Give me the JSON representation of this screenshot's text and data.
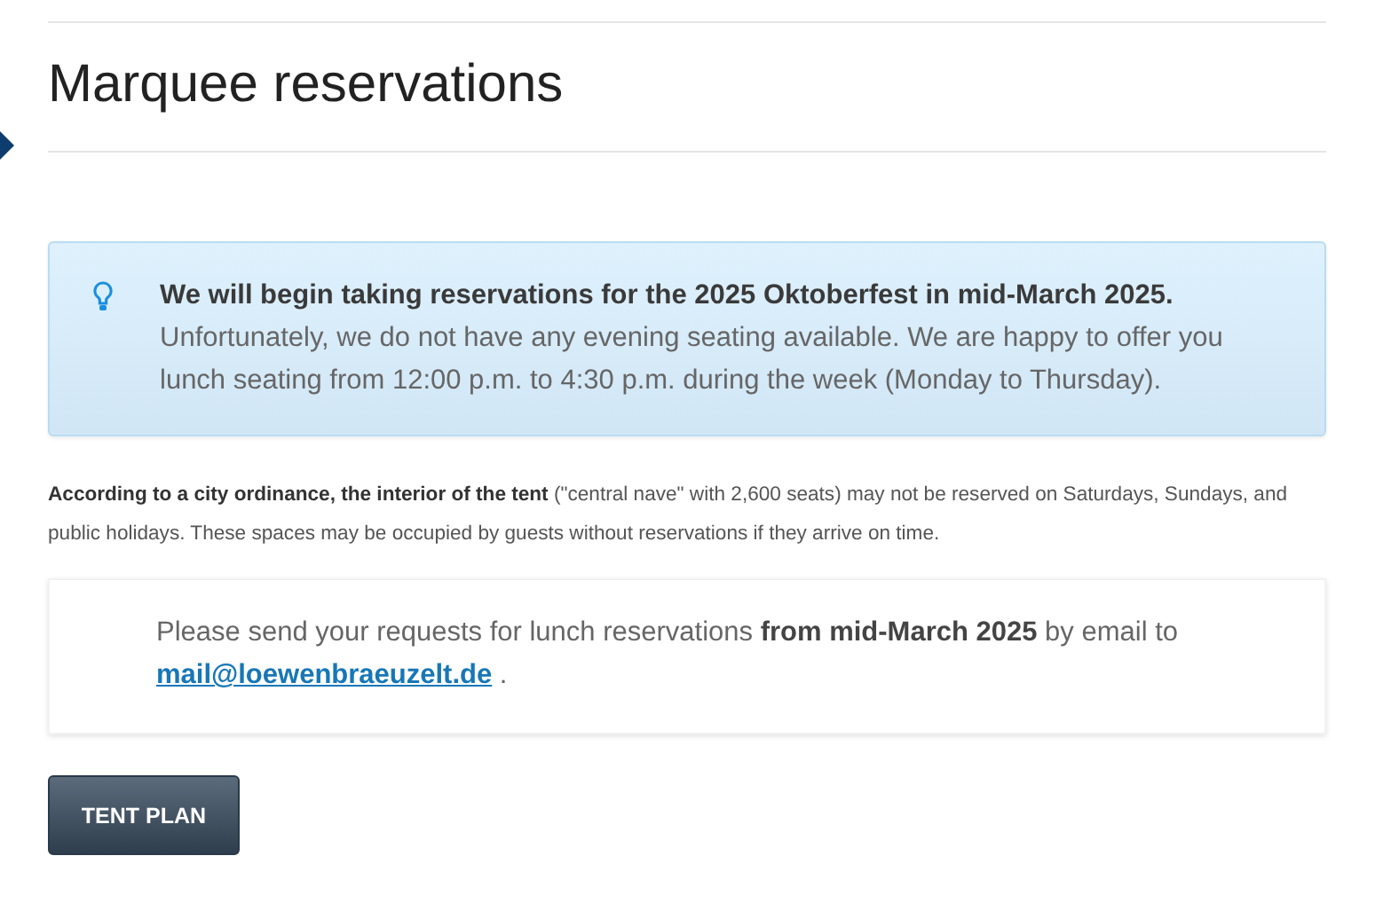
{
  "title": "Marquee reservations",
  "notice": {
    "headline": "We will begin taking reservations for the 2025 Oktoberfest in mid-March 2025.",
    "body": "Unfortunately, we do not have any evening seating available. We are happy to offer you lunch seating from 12:00 p.m. to 4:30 p.m. during the week (Monday to Thursday)."
  },
  "ordinance": "**According to a city ordinance, the interior of the tent** (\"central nave\" with 2,600 seats) may not be reserved on Saturdays, Sundays, and public holidays. These spaces may be occupied by guests without reservations if they arrive on time.",
  "request": {
    "text": "Please send your requests for lunch reservations **from mid-March 2025** by email to",
    "email": "mail@loewenbraeuzelt.de",
    "suffix": "."
  },
  "button": "TENT PLAN"
}
